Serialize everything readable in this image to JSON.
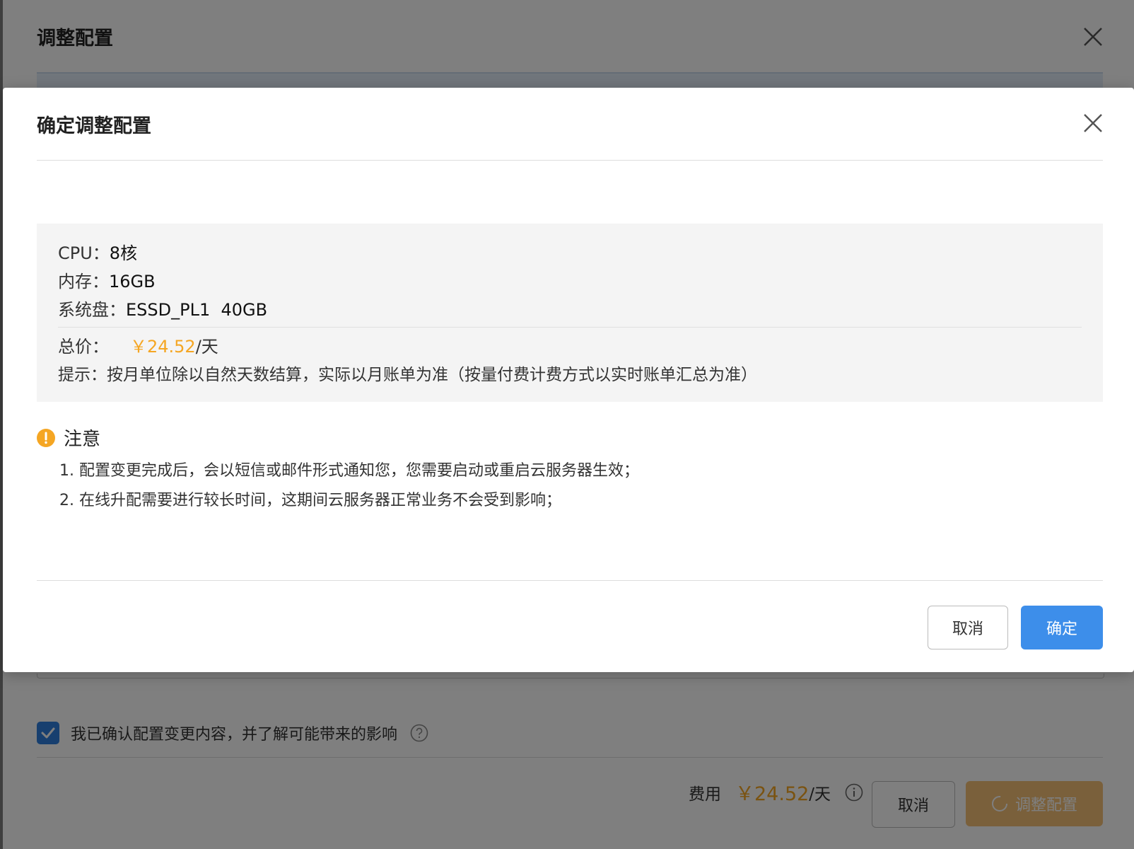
{
  "background": {
    "title": "调整配置",
    "confirm_label": "我已确认配置变更内容，并了解可能带来的影响",
    "fee_label": "费用",
    "fee_price": "￥24.52",
    "fee_unit": "/天",
    "cancel_label": "取消",
    "adjust_label": "调整配置"
  },
  "modal": {
    "title": "确定调整配置",
    "specs": {
      "cpu_label": "CPU：",
      "cpu_value": "8核",
      "mem_label": "内存：",
      "mem_value": "16GB",
      "disk_label": "系统盘：",
      "disk_value": "ESSD_PL1  40GB",
      "total_label": "总价：",
      "total_price": "￥24.52",
      "total_unit": "/天",
      "tip": "提示：按月单位除以自然天数结算，实际以月账单为准（按量付费计费方式以实时账单汇总为准）"
    },
    "notice": {
      "title": "注意",
      "items": [
        "1. 配置变更完成后，会以短信或邮件形式通知您，您需要启动或重启云服务器生效；",
        "2. 在线升配需要进行较长时间，这期间云服务器正常业务不会受到影响；"
      ]
    },
    "cancel_label": "取消",
    "ok_label": "确定"
  },
  "colors": {
    "accent": "#3d8eea",
    "price": "#f5a623",
    "warning": "#f5a623",
    "overlay": "rgba(0,0,0,0.5)"
  },
  "icons": {
    "close": "close-icon",
    "warning": "warning-icon",
    "help": "question-icon",
    "info": "info-icon",
    "check": "checkmark-icon",
    "spinner": "loading-spinner-icon"
  }
}
